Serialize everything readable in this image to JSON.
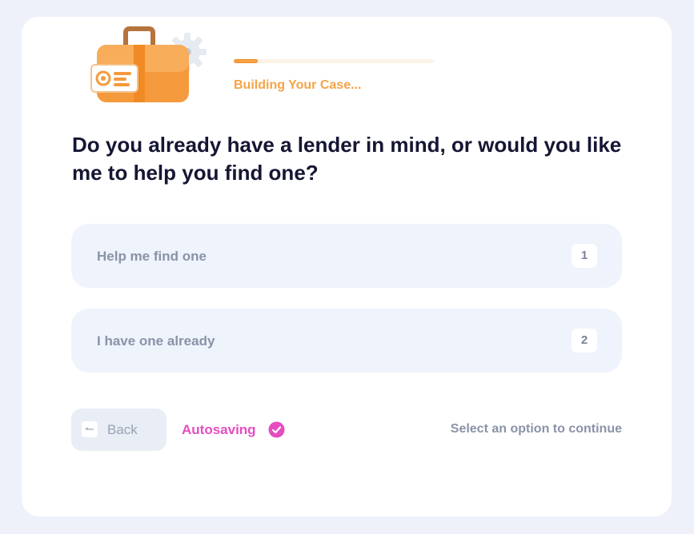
{
  "header": {
    "status": "Building Your Case...",
    "progress_fraction": 0.12,
    "illustration_icon": "briefcase-gear-icon"
  },
  "question": "Do you already have a lender in mind, or would you like me to help you find one?",
  "options": [
    {
      "label": "Help me find one",
      "key": "1"
    },
    {
      "label": "I have one already",
      "key": "2"
    }
  ],
  "footer": {
    "back_label": "Back",
    "autosave_label": "Autosaving",
    "hint": "Select an option to continue"
  },
  "colors": {
    "accent_orange": "#f5a347",
    "autosave_pink": "#e54dc1",
    "question_text": "#151633",
    "option_bg": "#eef3fc"
  }
}
